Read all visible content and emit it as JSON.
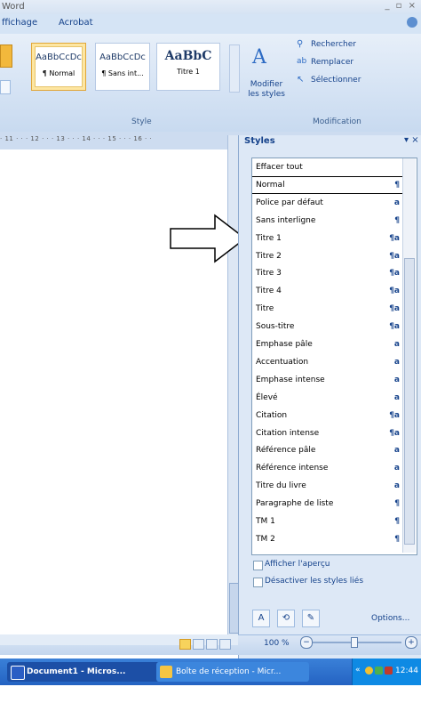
{
  "window": {
    "title": "Word",
    "controls": "_ ▫ ×"
  },
  "ribbon": {
    "tabs": [
      "ffichage",
      "Acrobat"
    ],
    "styles": [
      {
        "sample": "AaBbCcDc",
        "name": "¶ Normal"
      },
      {
        "sample": "AaBbCcDc",
        "name": "¶ Sans int..."
      },
      {
        "sample": "AaBbC",
        "name": "Titre 1"
      }
    ],
    "style_group_label": "Style",
    "modify_styles_label": "Modifier les styles",
    "search_label": "Rechercher",
    "replace_label": "Remplacer",
    "select_label": "Sélectionner",
    "modification_group_label": "Modification"
  },
  "ruler": {
    "text": "· 11 · · · 12 · · · 13 · · · 14 · · · 15 · · · 16 · ·"
  },
  "styles_pane": {
    "title": "Styles",
    "items": [
      {
        "name": "Effacer tout",
        "icon": ""
      },
      {
        "name": "Normal",
        "icon": "¶"
      },
      {
        "name": "Police par défaut",
        "icon": "a"
      },
      {
        "name": "Sans interligne",
        "icon": "¶"
      },
      {
        "name": "Titre 1",
        "icon": "¶a"
      },
      {
        "name": "Titre 2",
        "icon": "¶a"
      },
      {
        "name": "Titre 3",
        "icon": "¶a"
      },
      {
        "name": "Titre 4",
        "icon": "¶a"
      },
      {
        "name": "Titre",
        "icon": "¶a"
      },
      {
        "name": "Sous-titre",
        "icon": "¶a"
      },
      {
        "name": "Emphase pâle",
        "icon": "a"
      },
      {
        "name": "Accentuation",
        "icon": "a"
      },
      {
        "name": "Emphase intense",
        "icon": "a"
      },
      {
        "name": "Élevé",
        "icon": "a"
      },
      {
        "name": "Citation",
        "icon": "¶a"
      },
      {
        "name": "Citation intense",
        "icon": "¶a"
      },
      {
        "name": "Référence pâle",
        "icon": "a"
      },
      {
        "name": "Référence intense",
        "icon": "a"
      },
      {
        "name": "Titre du livre",
        "icon": "a"
      },
      {
        "name": "Paragraphe de liste",
        "icon": "¶"
      },
      {
        "name": "TM 1",
        "icon": "¶"
      },
      {
        "name": "TM 2",
        "icon": "¶"
      }
    ],
    "selected": "Normal",
    "show_preview": "Afficher l'aperçu",
    "disable_linked": "Désactiver les styles liés",
    "options": "Options..."
  },
  "status": {
    "zoom": "100 %"
  },
  "taskbar": {
    "tasks": [
      "Document1 - Micros...",
      "Boîte de réception - Micr..."
    ],
    "clock": "12:44"
  }
}
